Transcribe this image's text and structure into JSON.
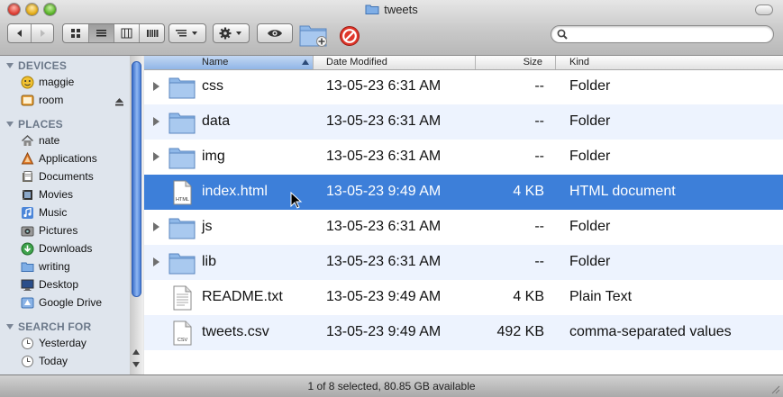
{
  "window": {
    "title": "tweets"
  },
  "toolbar": {
    "back_icon": "back-arrow-icon",
    "forward_icon": "forward-arrow-icon",
    "view_modes": [
      "icon-view",
      "list-view",
      "column-view",
      "cover-flow-view"
    ],
    "active_view": "list-view",
    "arrange_icon": "arrange-icon",
    "action_icon": "gear-icon",
    "quicklook_icon": "eye-icon",
    "new_folder_icon": "new-folder-icon",
    "delete_icon": "no-entry-icon",
    "search": {
      "value": "",
      "placeholder": ""
    }
  },
  "sidebar": {
    "sections": [
      {
        "label": "DEVICES",
        "items": [
          {
            "label": "maggie",
            "icon": "user-icon"
          },
          {
            "label": "room",
            "icon": "disk-icon",
            "ejectable": true
          }
        ]
      },
      {
        "label": "PLACES",
        "items": [
          {
            "label": "nate",
            "icon": "home-icon"
          },
          {
            "label": "Applications",
            "icon": "applications-icon"
          },
          {
            "label": "Documents",
            "icon": "documents-icon"
          },
          {
            "label": "Movies",
            "icon": "movies-icon"
          },
          {
            "label": "Music",
            "icon": "music-icon"
          },
          {
            "label": "Pictures",
            "icon": "pictures-icon"
          },
          {
            "label": "Downloads",
            "icon": "downloads-icon"
          },
          {
            "label": "writing",
            "icon": "folder-icon"
          },
          {
            "label": "Desktop",
            "icon": "desktop-icon"
          },
          {
            "label": "Google Drive",
            "icon": "google-drive-icon"
          }
        ]
      },
      {
        "label": "SEARCH FOR",
        "items": [
          {
            "label": "Yesterday",
            "icon": "clock-icon"
          },
          {
            "label": "Today",
            "icon": "clock-icon"
          }
        ]
      }
    ]
  },
  "columns": {
    "name": "Name",
    "date": "Date Modified",
    "size": "Size",
    "kind": "Kind"
  },
  "files": [
    {
      "name": "css",
      "date": "13-05-23 6:31 AM",
      "size": "--",
      "kind": "Folder",
      "type": "folder"
    },
    {
      "name": "data",
      "date": "13-05-23 6:31 AM",
      "size": "--",
      "kind": "Folder",
      "type": "folder"
    },
    {
      "name": "img",
      "date": "13-05-23 6:31 AM",
      "size": "--",
      "kind": "Folder",
      "type": "folder"
    },
    {
      "name": "index.html",
      "date": "13-05-23 9:49 AM",
      "size": "4 KB",
      "kind": "HTML document",
      "type": "html",
      "badge": "HTML",
      "selected": true
    },
    {
      "name": "js",
      "date": "13-05-23 6:31 AM",
      "size": "--",
      "kind": "Folder",
      "type": "folder"
    },
    {
      "name": "lib",
      "date": "13-05-23 6:31 AM",
      "size": "--",
      "kind": "Folder",
      "type": "folder"
    },
    {
      "name": "README.txt",
      "date": "13-05-23 9:49 AM",
      "size": "4 KB",
      "kind": "Plain Text",
      "type": "text"
    },
    {
      "name": "tweets.csv",
      "date": "13-05-23 9:49 AM",
      "size": "492 KB",
      "kind": "comma-separated values",
      "type": "csv",
      "badge": "CSV"
    }
  ],
  "status": {
    "text": "1 of 8 selected, 80.85 GB available"
  },
  "colors": {
    "selection": "#3d7fd9",
    "alt_row": "#edf3fe",
    "sidebar": "#dfe5ed"
  }
}
